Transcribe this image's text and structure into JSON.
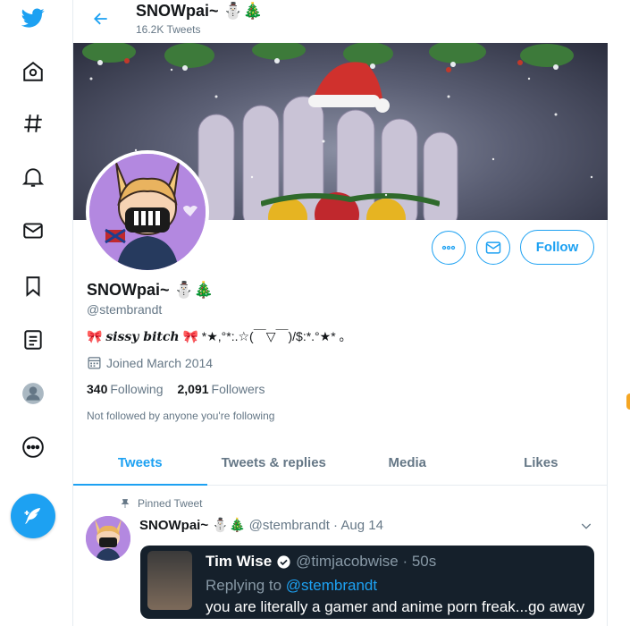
{
  "nav": {
    "items": [
      "twitter-logo",
      "home-icon",
      "explore-hashtag-icon",
      "notifications-bell-icon",
      "messages-envelope-icon",
      "bookmarks-icon",
      "lists-icon",
      "profile-icon",
      "more-icon"
    ],
    "compose_icon": "compose-feather-icon",
    "brand_color": "#1da1f2"
  },
  "header": {
    "name": "SNOWpai~ ⛄🎄",
    "tweet_count": "16.2K Tweets"
  },
  "profile": {
    "name": "SNOWpai~ ⛄🎄",
    "handle": "@stembrandt",
    "bio_prefix": "🎀 ",
    "bio_fancy": "sissy bitch",
    "bio_suffix": " 🎀 *★,°*:.☆(￣▽￣)/$:*.°★* 。",
    "joined": "Joined March 2014",
    "following_count": "340",
    "following_label": "Following",
    "followers_count": "2,091",
    "followers_label": "Followers",
    "not_followed": "Not followed by anyone you're following",
    "follow_button": "Follow"
  },
  "tabs": [
    {
      "label": "Tweets",
      "active": true
    },
    {
      "label": "Tweets & replies",
      "active": false
    },
    {
      "label": "Media",
      "active": false
    },
    {
      "label": "Likes",
      "active": false
    }
  ],
  "pinned_tweet": {
    "pinned_label": "Pinned Tweet",
    "name": "SNOWpai~ ⛄🎄",
    "handle_date": "@stembrandt · Aug 14",
    "quote": {
      "name": "Tim Wise",
      "handle_time": "@timjacobwise · 50s",
      "replying_prefix": "Replying to ",
      "replying_to": "@stembrandt",
      "text": "you are literally a gamer and anime porn freak...go away"
    }
  }
}
